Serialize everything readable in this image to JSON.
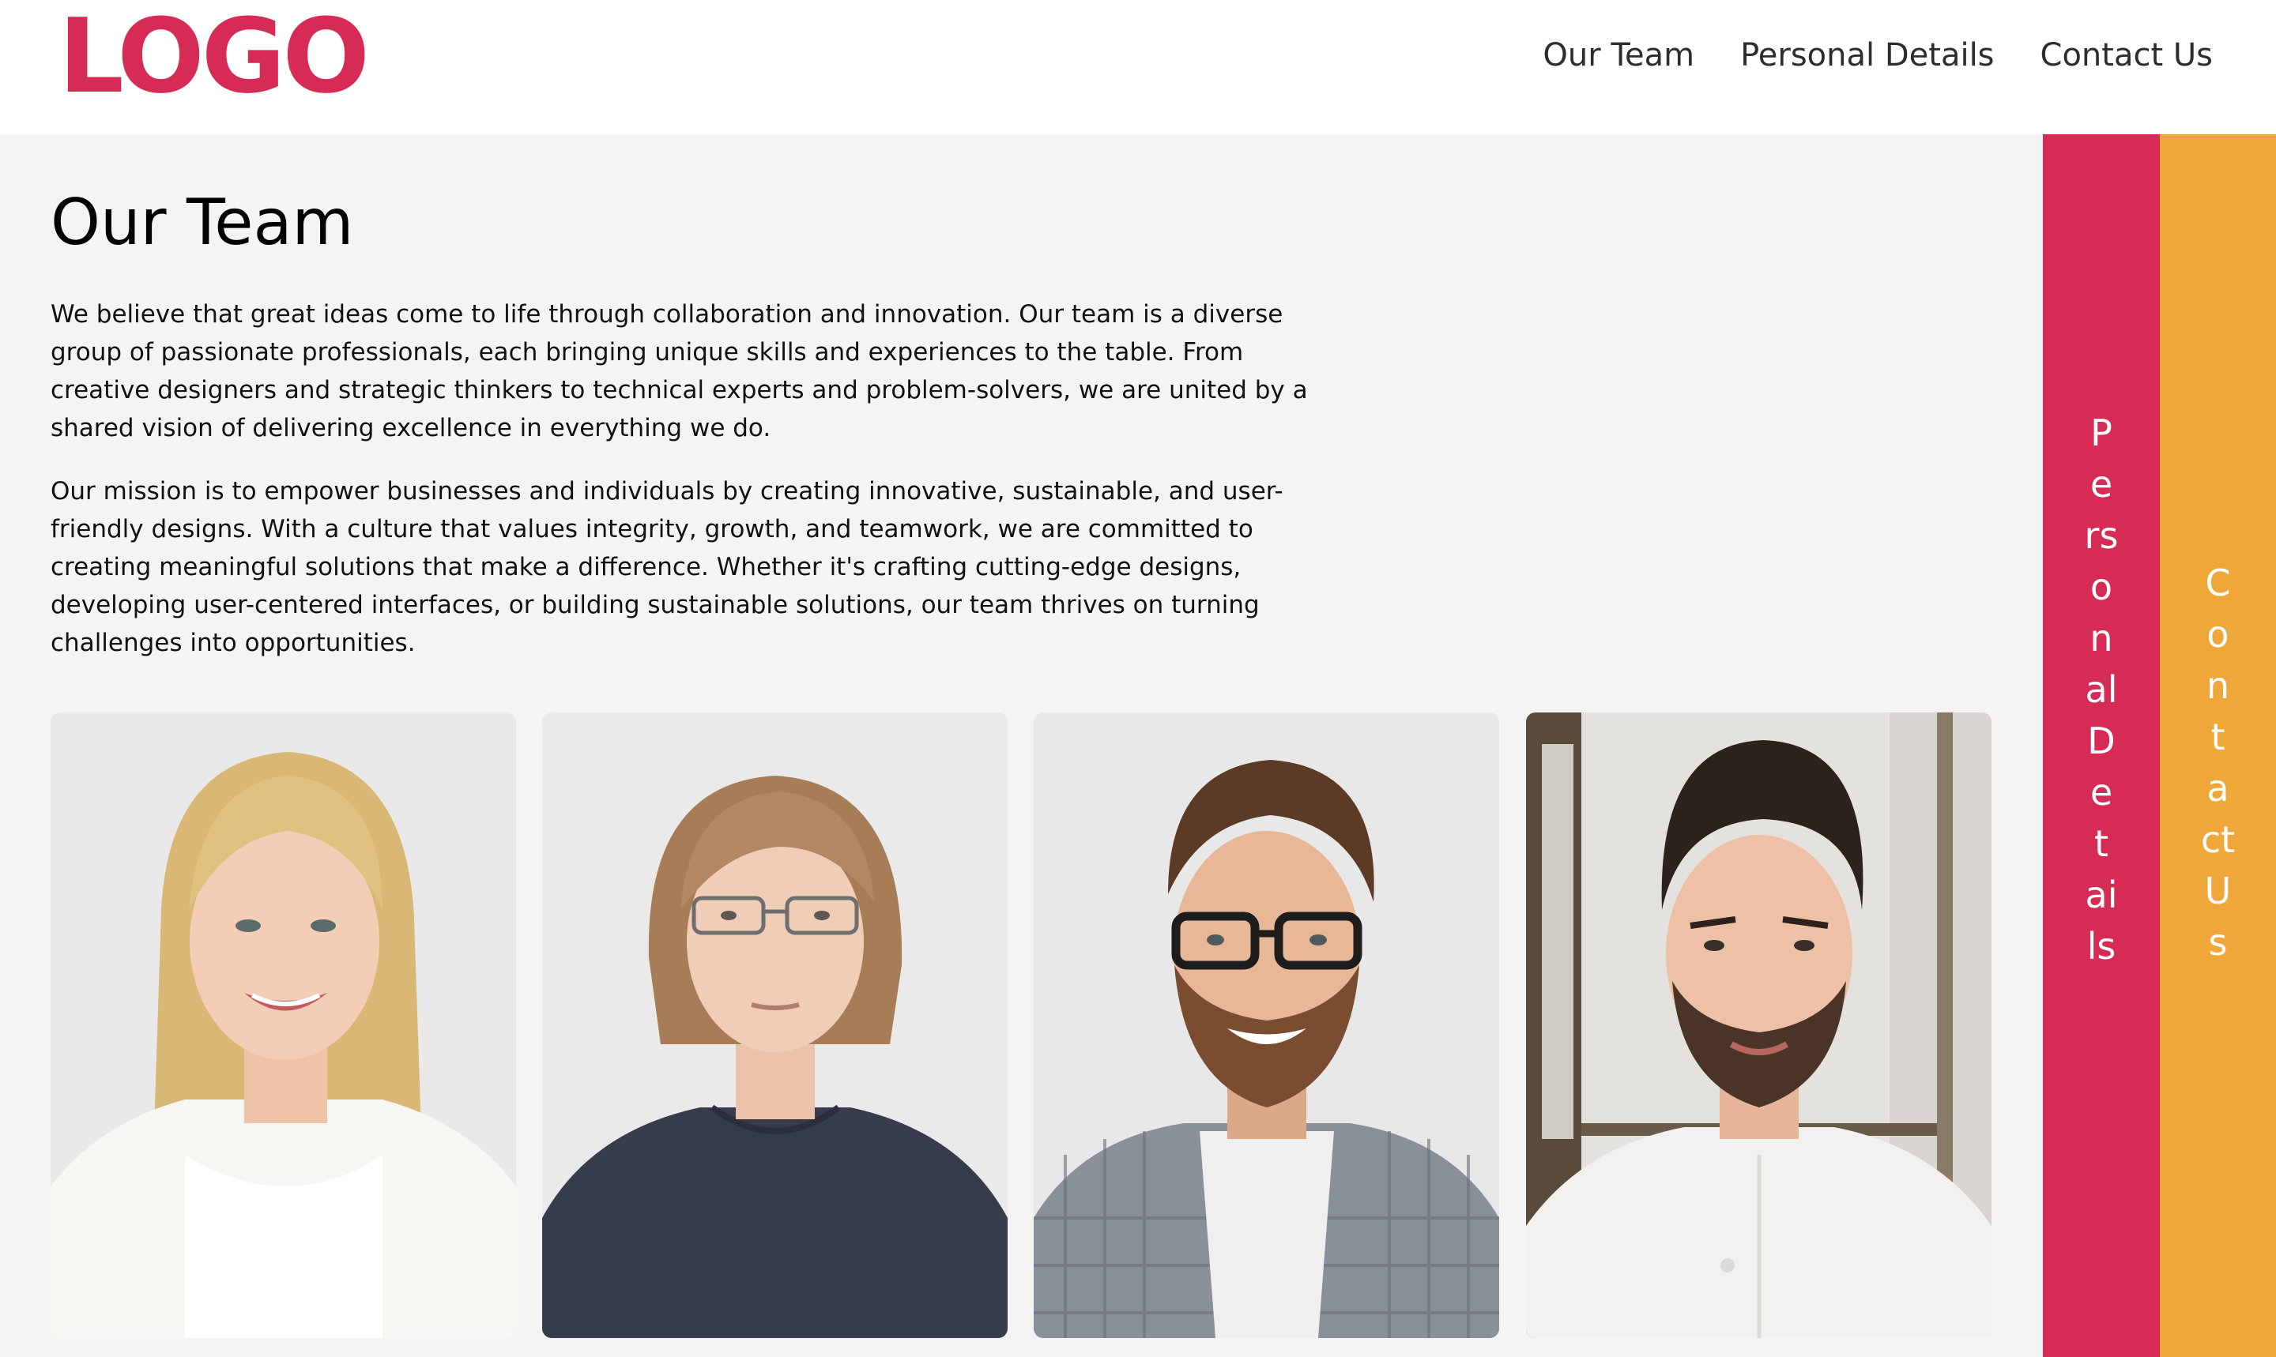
{
  "header": {
    "logo_text": "LOGO",
    "nav": {
      "our_team": "Our Team",
      "personal_details": "Personal Details",
      "contact_us": "Contact Us"
    }
  },
  "main": {
    "title": "Our Team",
    "paragraph_1": "We believe that great ideas come to life through collaboration and innovation. Our team is a diverse group of passionate professionals, each bringing unique skills and experiences to the table. From creative designers and strategic thinkers to technical experts and problem-solvers, we are united by a shared vision of delivering excellence in everything we do.",
    "paragraph_2": "Our mission is to empower businesses and individuals by creating innovative, sustainable, and user-friendly designs. With a culture that values integrity, growth, and teamwork, we are committed to creating meaningful solutions that make a difference. Whether it's crafting cutting-edge designs, developing user-centered interfaces, or building sustainable solutions, our team thrives on turning challenges into opportunities."
  },
  "side_tabs": {
    "personal_details": "Personal Details",
    "contact_us": "Contact Us"
  },
  "colors": {
    "brand_pink": "#d62b55",
    "brand_orange": "#f0a73a",
    "content_bg": "#f5f3f4"
  }
}
